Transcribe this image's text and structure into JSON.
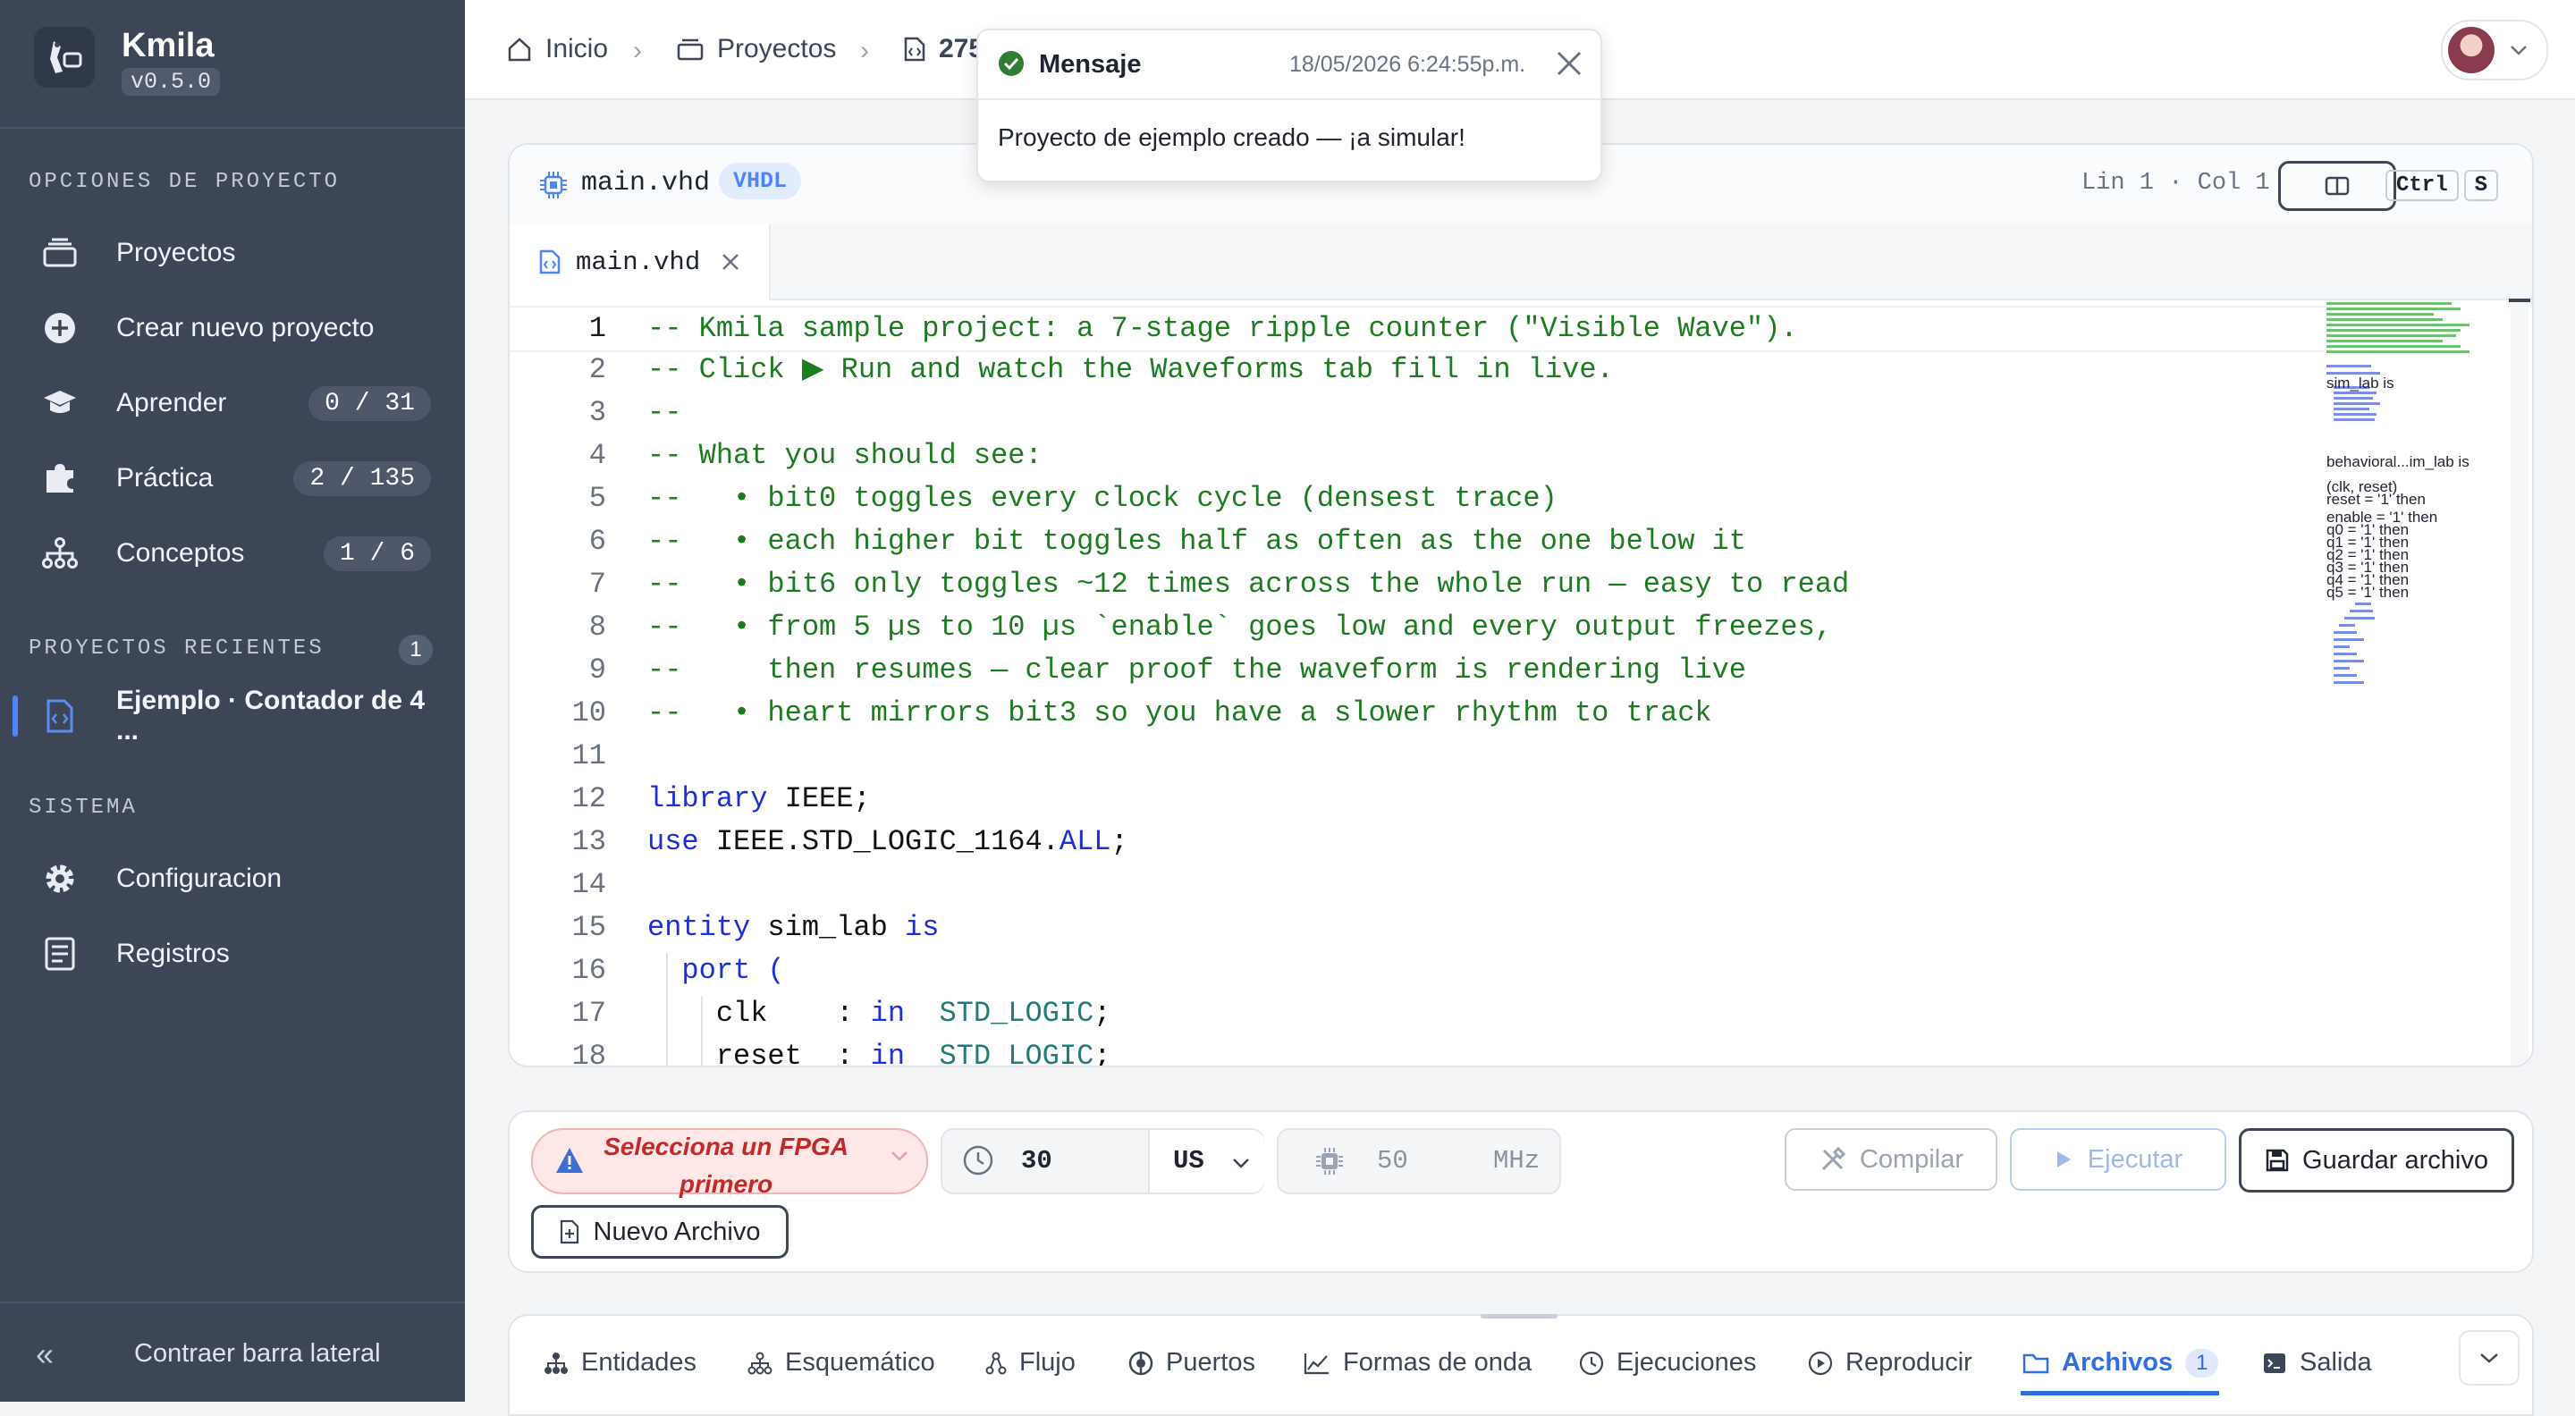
{
  "app": {
    "name": "Kmila",
    "version": "v0.5.0",
    "logo_text": "Kmila"
  },
  "sidebar": {
    "project_options_title": "OPCIONES DE PROYECTO",
    "items": [
      {
        "label": "Proyectos",
        "icon": "stack-icon"
      },
      {
        "label": "Crear nuevo proyecto",
        "icon": "plus-circle-icon"
      },
      {
        "label": "Aprender",
        "icon": "graduation-cap-icon",
        "badge": "0 / 31"
      },
      {
        "label": "Práctica",
        "icon": "puzzle-icon",
        "badge": "2 / 135"
      },
      {
        "label": "Conceptos",
        "icon": "hierarchy-icon",
        "badge": "1 / 6"
      }
    ],
    "recent_title": "PROYECTOS RECIENTES",
    "recent_count": "1",
    "recent_items": [
      {
        "label": "Ejemplo · Contador de 4 ...",
        "icon": "code-file-icon"
      }
    ],
    "system_title": "SISTEMA",
    "system_items": [
      {
        "label": "Configuracion",
        "icon": "gear-icon"
      },
      {
        "label": "Registros",
        "icon": "log-icon"
      }
    ],
    "collapse_label": "Contraer barra lateral"
  },
  "breadcrumb": {
    "home": "Inicio",
    "projects": "Proyectos",
    "current": "275"
  },
  "toast": {
    "title": "Mensaje",
    "timestamp": "18/05/2026 6:24:55p.m.",
    "message": "Proyecto de ejemplo creado — ¡a simular!",
    "status_color": "#2e7d32"
  },
  "editor": {
    "filename": "main.vhd",
    "language": "VHDL",
    "cursor_status": "Lin 1 · Col 1",
    "shortcut_keys": [
      "Ctrl",
      "S"
    ],
    "tab_label": "main.vhd",
    "lines": [
      [
        [
          "cm",
          "-- Kmila sample project: a 7-stage ripple counter (\"Visible Wave\").  "
        ]
      ],
      [
        [
          "cm",
          "-- Click ▶ Run and watch the Waveforms tab fill in live."
        ]
      ],
      [
        [
          "cm",
          "--"
        ]
      ],
      [
        [
          "cm",
          "-- What you should see:"
        ]
      ],
      [
        [
          "cm",
          "--   • bit0 toggles every clock cycle (densest trace)"
        ]
      ],
      [
        [
          "cm",
          "--   • each higher bit toggles half as often as the one below it"
        ]
      ],
      [
        [
          "cm",
          "--   • bit6 only toggles ~12 times across the whole run — easy to read"
        ]
      ],
      [
        [
          "cm",
          "--   • from 5 µs to 10 µs `enable` goes low and every output freezes,"
        ]
      ],
      [
        [
          "cm",
          "--     then resumes — clear proof the waveform is rendering live"
        ]
      ],
      [
        [
          "cm",
          "--   • heart mirrors bit3 so you have a slower rhythm to track"
        ]
      ],
      [],
      [
        [
          "kw",
          "library"
        ],
        [
          "tx",
          " IEEE;"
        ]
      ],
      [
        [
          "kw",
          "use"
        ],
        [
          "tx",
          " IEEE.STD_LOGIC_1164."
        ],
        [
          "kw",
          "ALL"
        ],
        [
          "tx",
          ";"
        ]
      ],
      [],
      [
        [
          "kw",
          "entity"
        ],
        [
          "tx",
          " sim_lab "
        ],
        [
          "kw",
          "is"
        ]
      ],
      [
        [
          "tx",
          "  "
        ],
        [
          "kw",
          "port"
        ],
        [
          "tx",
          " "
        ],
        [
          "kw",
          "("
        ]
      ],
      [
        [
          "tx",
          "    clk    : "
        ],
        [
          "kw",
          "in"
        ],
        [
          "tx",
          "  "
        ],
        [
          "ty",
          "STD_LOGIC"
        ],
        [
          "tx",
          ";"
        ]
      ],
      [
        [
          "tx",
          "    reset  : "
        ],
        [
          "kw",
          "in"
        ],
        [
          "tx",
          "  "
        ],
        [
          "ty",
          "STD_LOGIC"
        ],
        [
          "tx",
          ";"
        ]
      ]
    ],
    "minimap_labels": [
      "sim_lab is",
      "behavioral...im_lab is",
      "(clk, reset)",
      "reset = '1' then",
      "enable = '1' then",
      "q0 = '1' then",
      "q1 = '1' then",
      "q2 = '1' then",
      "q3 = '1' then",
      "q4 = '1' then",
      "q5 = '1' then"
    ]
  },
  "toolbar": {
    "fpga_warning": "Selecciona un FPGA primero",
    "time_value": "30",
    "time_unit": "US",
    "freq_value": "50",
    "freq_unit": "MHz",
    "compile_label": "Compilar",
    "run_label": "Ejecutar",
    "save_label": "Guardar archivo",
    "new_file_label": "Nuevo Archivo",
    "warning_color": "#c62828",
    "accent_color": "#3b6fd4"
  },
  "bottom_tabs": [
    {
      "label": "Entidades",
      "icon": "entities-icon"
    },
    {
      "label": "Esquemático",
      "icon": "schematic-icon"
    },
    {
      "label": "Flujo",
      "icon": "flow-icon"
    },
    {
      "label": "Puertos",
      "icon": "ports-icon"
    },
    {
      "label": "Formas de onda",
      "icon": "waveform-icon"
    },
    {
      "label": "Ejecuciones",
      "icon": "clock-icon"
    },
    {
      "label": "Reproducir",
      "icon": "play-circle-icon"
    },
    {
      "label": "Archivos",
      "icon": "folder-icon",
      "badge": "1",
      "active": true
    },
    {
      "label": "Salida",
      "icon": "terminal-icon"
    }
  ]
}
